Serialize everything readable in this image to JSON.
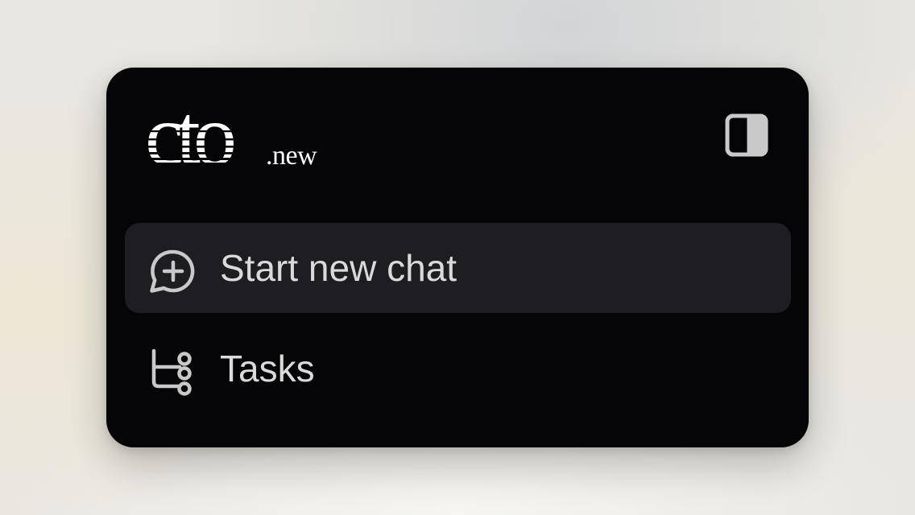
{
  "brand": {
    "logo_main": "cto",
    "logo_sub": ".new"
  },
  "header": {
    "toggle_icon": "sidebar-toggle-icon"
  },
  "menu": {
    "items": [
      {
        "label": "Start new chat",
        "icon": "chat-plus-icon",
        "active": true
      },
      {
        "label": "Tasks",
        "icon": "tasks-flow-icon",
        "active": false
      }
    ]
  },
  "colors": {
    "panel_bg": "#050407",
    "active_item_bg": "#1e1d22",
    "text": "#dadada",
    "icon": "#c9c9c9"
  }
}
